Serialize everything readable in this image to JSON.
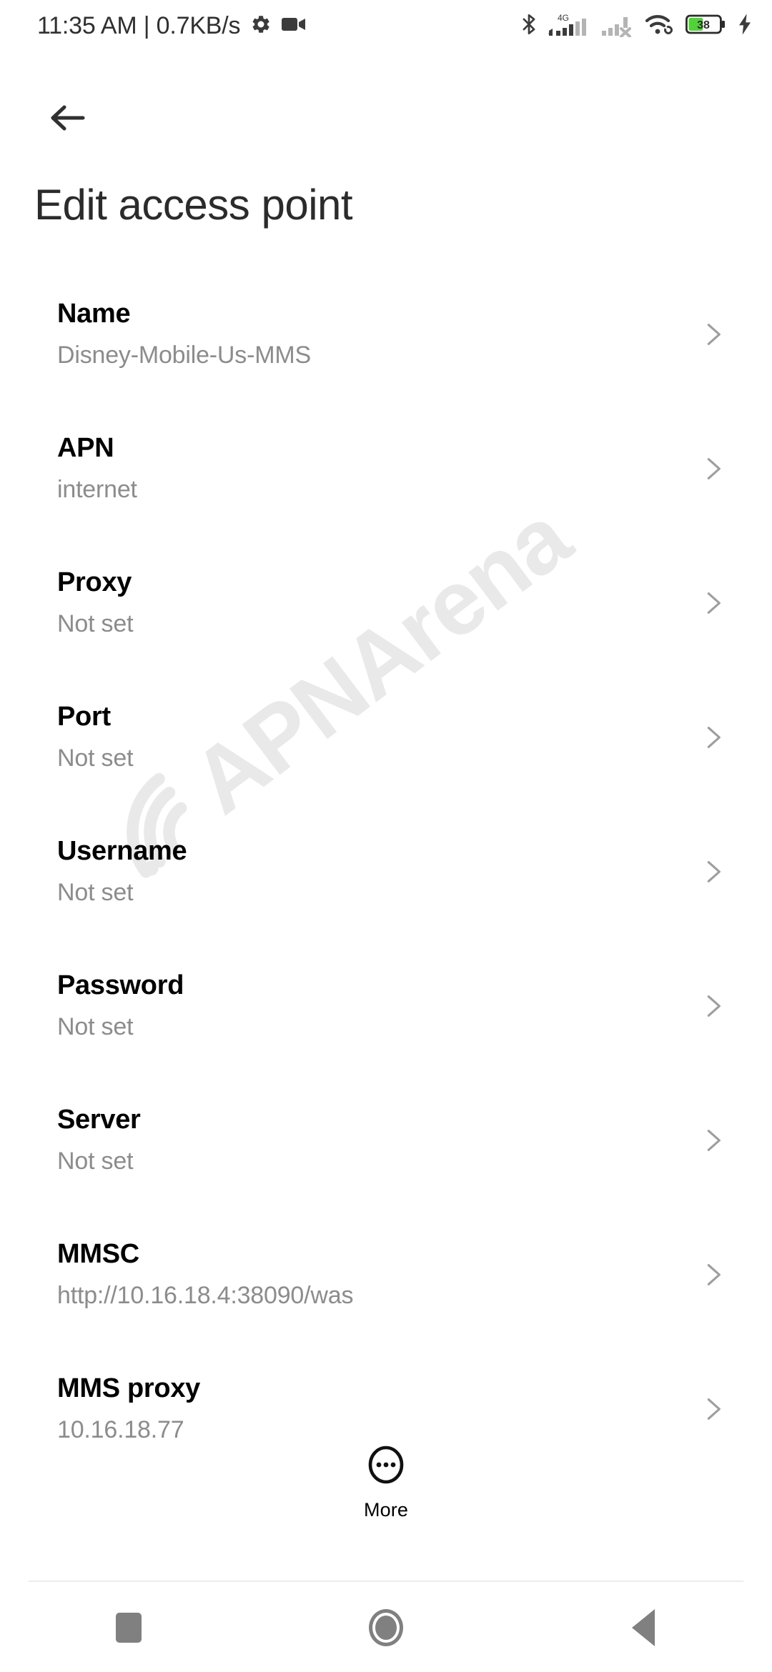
{
  "status_bar": {
    "clock": "11:35 AM | 0.7KB/s",
    "left_icons": [
      "gear-icon",
      "video-camera-icon"
    ],
    "right_icons": [
      "bluetooth-icon",
      "signal-4g-icon",
      "signal-sim2-off-icon",
      "wifi-icon",
      "battery-icon",
      "charging-bolt-icon"
    ],
    "network_label": "4G",
    "battery_level": "38",
    "battery_color": "#53d13a"
  },
  "header": {
    "back_icon": "arrow-left-icon",
    "title": "Edit access point"
  },
  "watermark": {
    "text": "APNArena",
    "color": "#e9e9e9"
  },
  "settings": {
    "chevron_icon": "chevron-right-icon",
    "rows": [
      {
        "label": "Name",
        "value": "Disney-Mobile-Us-MMS"
      },
      {
        "label": "APN",
        "value": "internet"
      },
      {
        "label": "Proxy",
        "value": "Not set"
      },
      {
        "label": "Port",
        "value": "Not set"
      },
      {
        "label": "Username",
        "value": "Not set"
      },
      {
        "label": "Password",
        "value": "Not set"
      },
      {
        "label": "Server",
        "value": "Not set"
      },
      {
        "label": "MMSC",
        "value": "http://10.16.18.4:38090/was"
      },
      {
        "label": "MMS proxy",
        "value": "10.16.18.77"
      }
    ]
  },
  "more_button": {
    "label": "More",
    "icon": "circle-ellipsis-icon"
  },
  "nav_bar": {
    "items": [
      {
        "name": "recents-button",
        "icon": "square-icon"
      },
      {
        "name": "home-button",
        "icon": "circle-icon"
      },
      {
        "name": "back-button",
        "icon": "triangle-left-icon"
      }
    ]
  }
}
